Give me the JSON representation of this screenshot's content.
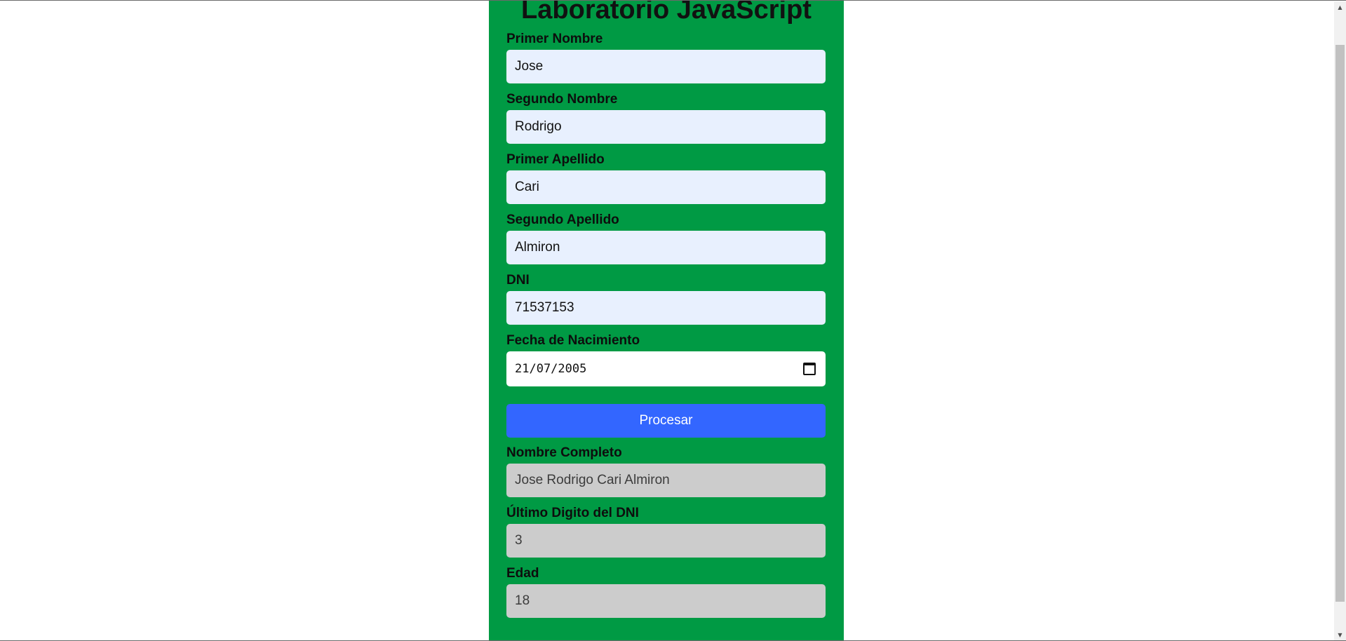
{
  "page": {
    "title": "Laboratorio JavaScript"
  },
  "form": {
    "primer_nombre": {
      "label": "Primer Nombre",
      "value": "Jose"
    },
    "segundo_nombre": {
      "label": "Segundo Nombre",
      "value": "Rodrigo"
    },
    "primer_apellido": {
      "label": "Primer Apellido",
      "value": "Cari"
    },
    "segundo_apellido": {
      "label": "Segundo Apellido",
      "value": "Almiron"
    },
    "dni": {
      "label": "DNI",
      "value": "71537153"
    },
    "fecha_nacimiento": {
      "label": "Fecha de Nacimiento",
      "value": "21/07/2005",
      "icon": "calendar-icon"
    },
    "submit_label": "Procesar"
  },
  "results": {
    "nombre_completo": {
      "label": "Nombre Completo",
      "value": "Jose Rodrigo Cari Almiron"
    },
    "ultimo_digito": {
      "label": "Último Digito del DNI",
      "value": "3"
    },
    "edad": {
      "label": "Edad",
      "value": "18"
    }
  },
  "colors": {
    "panel_background": "#009a44",
    "input_background": "#e8f0fe",
    "readonly_background": "#cccccc",
    "button_background": "#3366ff"
  }
}
